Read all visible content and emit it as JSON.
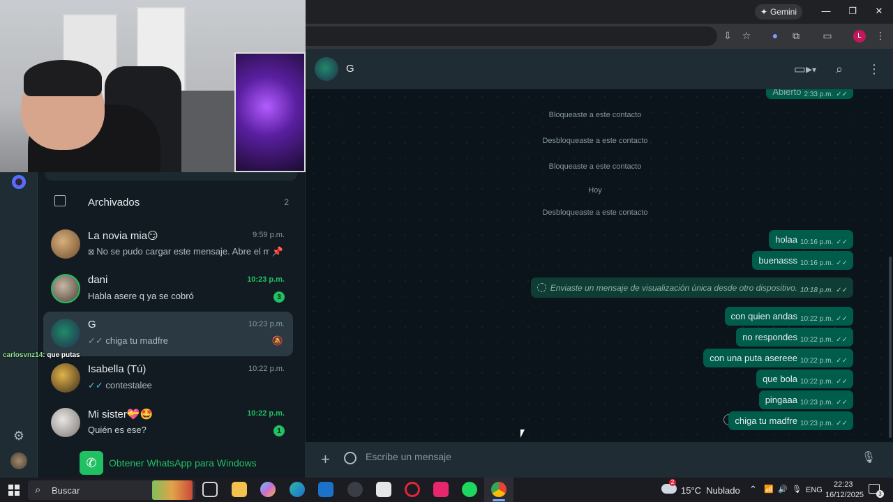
{
  "browser": {
    "gemini_label": "Gemini",
    "profile_initial": "L"
  },
  "webcam": {
    "description": ""
  },
  "stream_chat": {
    "user": "carlosvnz14",
    "message": ": que putas"
  },
  "chat_list": {
    "archived_label": "Archivados",
    "archived_count": "2",
    "items": [
      {
        "name": "La novia mia😏",
        "time": "9:59 p.m.",
        "preview": "No se pudo cargar este mensaje. Abre el me...",
        "unread": ""
      },
      {
        "name": "dani",
        "time": "10:23 p.m.",
        "preview": "Habla asere q ya se cobró",
        "unread": "3"
      },
      {
        "name": "G",
        "time": "10:23 p.m.",
        "preview": "chiga tu madfre",
        "unread": ""
      },
      {
        "name": "Isabella (Tú)",
        "time": "10:22 p.m.",
        "preview": "contestalee",
        "unread": ""
      },
      {
        "name": "Mi sister💝🤩",
        "time": "10:22 p.m.",
        "preview": "Quién es ese?",
        "unread": "1"
      }
    ],
    "get_app_label": "Obtener WhatsApp para Windows"
  },
  "chat_header": {
    "name": "G"
  },
  "conversation": {
    "top_partial": {
      "text": "Abierto",
      "time": "2:33 p.m."
    },
    "system_messages": [
      "Bloqueaste a este contacto",
      "Desbloqueaste a este contacto",
      "Bloqueaste a este contacto",
      "Hoy",
      "Desbloqueaste a este contacto"
    ],
    "messages": [
      {
        "text": "holaa",
        "time": "10:16 p.m."
      },
      {
        "text": "buenasss",
        "time": "10:16 p.m."
      },
      {
        "text": "Enviaste un mensaje de visualización única desde otro dispositivo.",
        "time": "10:18 p.m."
      },
      {
        "text": "con quien andas",
        "time": "10:22 p.m."
      },
      {
        "text": "no respondes",
        "time": "10:22 p.m."
      },
      {
        "text": "con una puta asereee",
        "time": "10:22 p.m."
      },
      {
        "text": "que bola",
        "time": "10:22 p.m."
      },
      {
        "text": "pingaaa",
        "time": "10:23 p.m."
      },
      {
        "text": "chiga tu madfre",
        "time": "10:23 p.m."
      }
    ]
  },
  "composer": {
    "placeholder": "Escribe un mensaje"
  },
  "taskbar": {
    "search_label": "Buscar",
    "weather": "15°C  Nublado",
    "weather_badge": "2",
    "language": "ENG",
    "time": "22:23",
    "date": "16/12/2025",
    "notification_count": "3"
  }
}
